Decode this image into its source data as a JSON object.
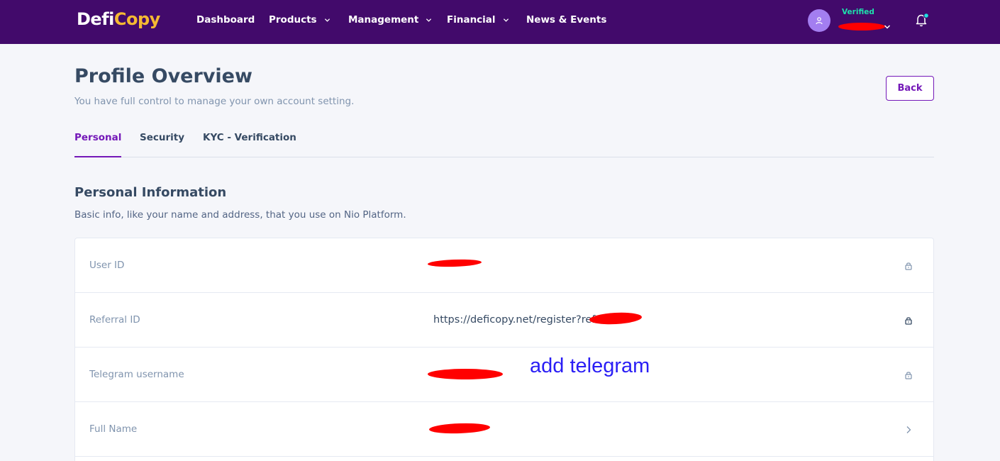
{
  "header": {
    "logo_part1": "Defi",
    "logo_part2": "Copy",
    "nav": [
      {
        "label": "Dashboard"
      },
      {
        "label": "Products"
      },
      {
        "label": "Management"
      },
      {
        "label": "Financial"
      },
      {
        "label": "News & Events"
      }
    ],
    "user_status": "Verified"
  },
  "page": {
    "title": "Profile Overview",
    "subtitle": "You have full control to manage your own account setting.",
    "back_label": "Back"
  },
  "tabs": [
    {
      "label": "Personal",
      "active": true
    },
    {
      "label": "Security",
      "active": false
    },
    {
      "label": "KYC - Verification",
      "active": false
    }
  ],
  "section": {
    "title": "Personal Information",
    "subtitle": "Basic info, like your name and address, that you use on Nio Platform."
  },
  "rows": [
    {
      "label": "User ID",
      "value": "",
      "icon": "lock-icon"
    },
    {
      "label": "Referral ID",
      "value": "https://deficopy.net/register?ref=6",
      "icon": "lock-icon"
    },
    {
      "label": "Telegram username",
      "value": "",
      "icon": "lock-icon"
    },
    {
      "label": "Full Name",
      "value": "",
      "icon": "chevron-right-icon"
    }
  ],
  "annotation": "add telegram",
  "colors": {
    "header_bg": "#420a6b",
    "accent": "#7418b8",
    "verified": "#1ee0ac",
    "redaction": "#ff0000",
    "annotation": "#2a1ef5"
  }
}
